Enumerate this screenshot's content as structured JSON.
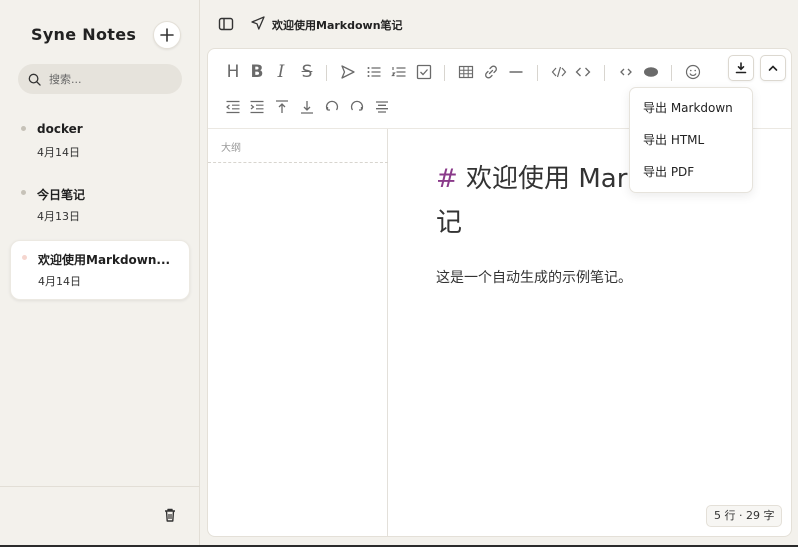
{
  "app": {
    "name": "Syne Notes"
  },
  "search": {
    "placeholder": "搜索..."
  },
  "notes": [
    {
      "title": "docker",
      "date": "4月14日"
    },
    {
      "title": "今日笔记",
      "date": "4月13日"
    },
    {
      "title": "欢迎使用Markdown...",
      "date": "4月14日"
    }
  ],
  "header": {
    "title": "欢迎使用Markdown笔记"
  },
  "outline": {
    "label": "大纲"
  },
  "document": {
    "heading_mark": "#",
    "heading_line1": " 欢迎使用 Markdown",
    "heading_line2": "记",
    "paragraph": "这是一个自动生成的示例笔记。"
  },
  "export_menu": {
    "items": [
      "导出 Markdown",
      "导出 HTML",
      "导出 PDF"
    ]
  },
  "status": {
    "text": "5 行 · 29 字"
  },
  "icons": {
    "row1": [
      "heading-icon",
      "bold-icon",
      "italic-icon",
      "strikethrough-icon",
      "send-icon",
      "bullet-list-icon",
      "ordered-list-icon",
      "checklist-icon",
      "table-icon",
      "link-icon",
      "horizontal-rule-icon",
      "code-block-icon",
      "inline-code-icon",
      "collapse-icon",
      "preview-icon",
      "emoji-icon",
      "download-icon",
      "chevron-up-icon"
    ],
    "row2": [
      "outdent-icon",
      "indent-icon",
      "insert-before-icon",
      "insert-after-icon",
      "undo-icon",
      "redo-icon",
      "align-icon"
    ]
  },
  "colors": {
    "accent": "#8a3a8a",
    "background": "#f3f1ec"
  }
}
